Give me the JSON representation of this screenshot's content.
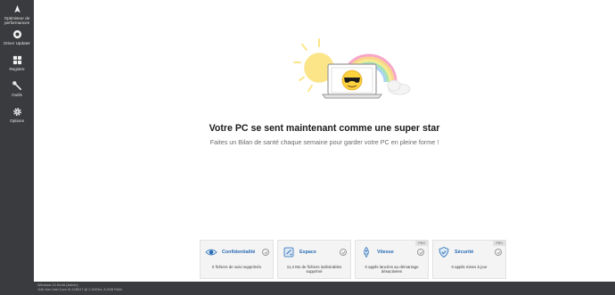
{
  "sidebar": {
    "items": [
      {
        "label": "Optimiseur de\nperformances",
        "icon": "rocket-icon"
      },
      {
        "label": "Driver Updater",
        "icon": "driver-icon"
      },
      {
        "label": "Registre",
        "icon": "registry-icon"
      },
      {
        "label": "Outils",
        "icon": "tools-icon"
      },
      {
        "label": "Options",
        "icon": "gear-icon"
      }
    ]
  },
  "main": {
    "headline": "Votre PC se sent maintenant comme une super star",
    "subline": "Faites un Bilan de santé chaque semaine pour garder votre PC en pleine forme !"
  },
  "cards": [
    {
      "title": "Confidentialité",
      "desc": "0 fichiers de suivi supprimés",
      "pro": "",
      "icon": "privacy-icon"
    },
    {
      "title": "Espace",
      "desc": "11,4 Mo de fichiers indésirables supprimé",
      "pro": "",
      "icon": "disk-space-icon"
    },
    {
      "title": "Vitesse",
      "desc": "0 applis lancées au démarrage désactivées",
      "pro": "PRO",
      "icon": "speed-rocket-icon"
    },
    {
      "title": "Sécurité",
      "desc": "0 applis mises à jour",
      "pro": "PRO",
      "icon": "shield-icon"
    }
  ],
  "status": {
    "text": "Windows 10 64-bit (Admin)\n11th Gen Intel Core i5-1135G7 @ 2.40GHz, 8.0GB RAM"
  },
  "colors": {
    "sidebar": "#3a3b3e",
    "accent": "#2a6db5",
    "sun": "#fce589"
  }
}
